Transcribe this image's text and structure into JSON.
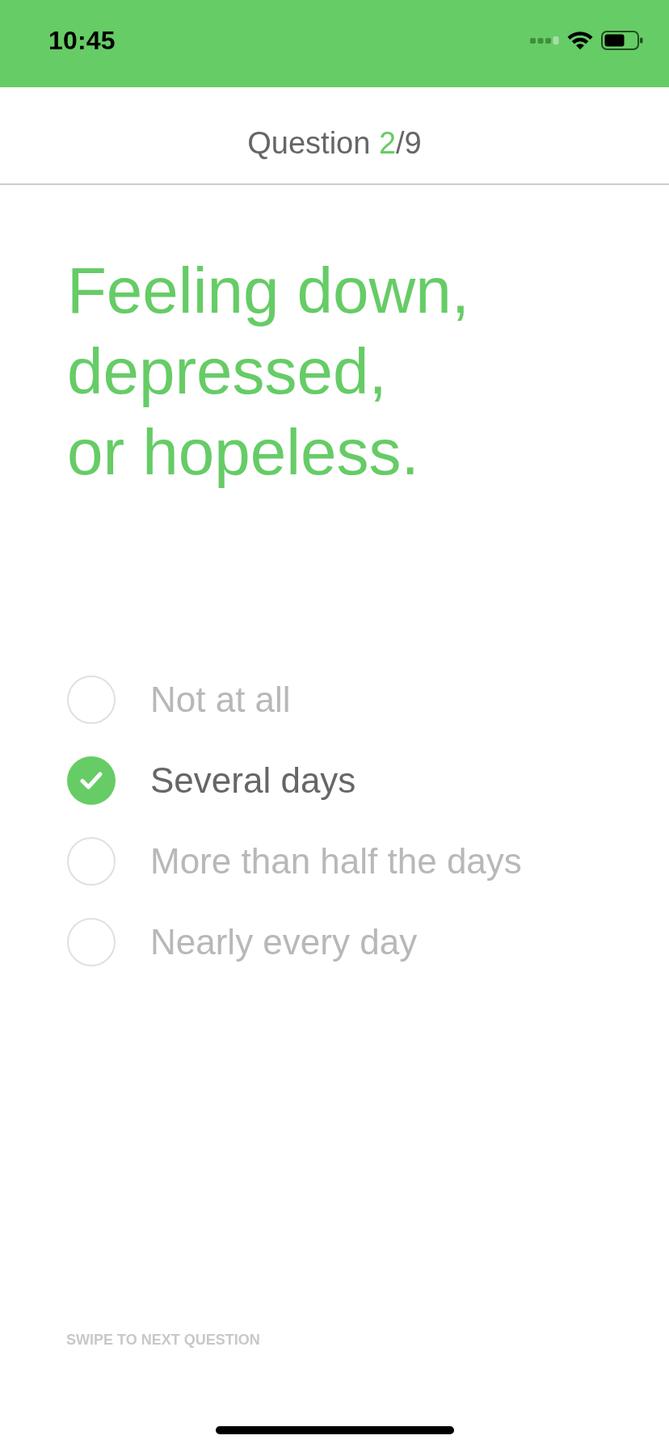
{
  "status_bar": {
    "time": "10:45"
  },
  "header": {
    "counter": [
      {
        "text": "Question ",
        "highlighted": false
      },
      {
        "text": "2",
        "highlighted": true
      },
      {
        "text": "/9",
        "highlighted": false
      }
    ]
  },
  "question": {
    "text": "Feeling down,\ndepressed,\nor hopeless."
  },
  "options": [
    {
      "label": "Not at all",
      "selected": false
    },
    {
      "label": "Several days",
      "selected": true
    },
    {
      "label": "More than half the days",
      "selected": false
    },
    {
      "label": "Nearly every day",
      "selected": false
    }
  ],
  "footer": {
    "hint": "SWIPE TO NEXT QUESTION"
  }
}
